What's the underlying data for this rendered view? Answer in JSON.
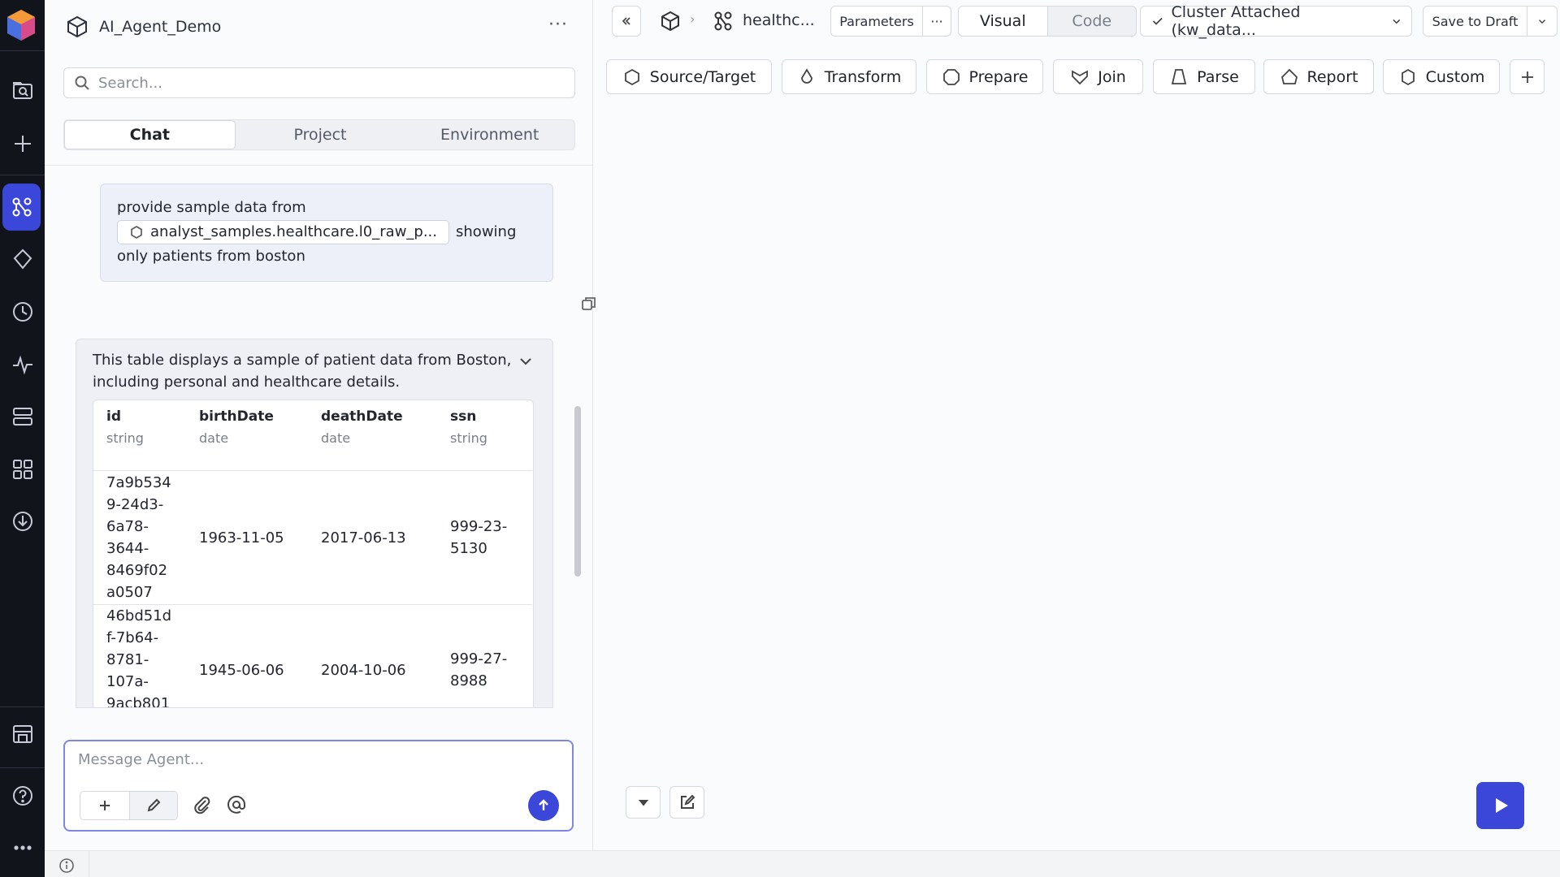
{
  "project": {
    "title": "AI_Agent_Demo"
  },
  "search": {
    "placeholder": "Search..."
  },
  "tabs": [
    {
      "label": "Chat"
    },
    {
      "label": "Project"
    },
    {
      "label": "Environment"
    }
  ],
  "chat": {
    "user_message": {
      "prefix": "provide sample data from",
      "chip": "analyst_samples.healthcare.l0_raw_p...",
      "suffix": "showing",
      "suffix2": "only patients from boston"
    },
    "agent_response": {
      "description": "This table displays a sample of patient data from Boston, including personal and healthcare details.",
      "table": {
        "columns": [
          {
            "name": "id",
            "type": "string"
          },
          {
            "name": "birthDate",
            "type": "date"
          },
          {
            "name": "deathDate",
            "type": "date"
          },
          {
            "name": "ssn",
            "type": "string"
          }
        ],
        "rows": [
          {
            "id_lines": [
              "7a9b534",
              "9-24d3-",
              "6a78-",
              "3644-",
              "8469f02",
              "a0507"
            ],
            "birthDate": "1963-11-05",
            "deathDate": "2017-06-13",
            "ssn_lines": [
              "999-23-",
              "5130"
            ]
          },
          {
            "id_lines": [
              "46bd51d",
              "f-7b64-",
              "8781-",
              "107a-",
              "9acb801"
            ],
            "birthDate": "1945-06-06",
            "deathDate": "2004-10-06",
            "ssn_lines": [
              "999-27-",
              "8988"
            ]
          }
        ]
      }
    }
  },
  "composer": {
    "placeholder": "Message Agent..."
  },
  "topbar": {
    "breadcrumb": "healthc...",
    "parameters_label": "Parameters",
    "more_label": "···",
    "view_tabs": [
      {
        "label": "Visual"
      },
      {
        "label": "Code"
      }
    ],
    "cluster_label": "Cluster Attached (kw_data...",
    "save_label": "Save to Draft"
  },
  "gems": [
    {
      "label": "Source/Target",
      "icon": "hexagon-icon"
    },
    {
      "label": "Transform",
      "icon": "drop-icon"
    },
    {
      "label": "Prepare",
      "icon": "circle-icon"
    },
    {
      "label": "Join",
      "icon": "heart-icon"
    },
    {
      "label": "Parse",
      "icon": "bell-icon"
    },
    {
      "label": "Report",
      "icon": "house-icon"
    },
    {
      "label": "Custom",
      "icon": "hexagon-icon"
    }
  ],
  "colors": {
    "accent": "#3b47d9",
    "rail_bg": "#12141c"
  }
}
